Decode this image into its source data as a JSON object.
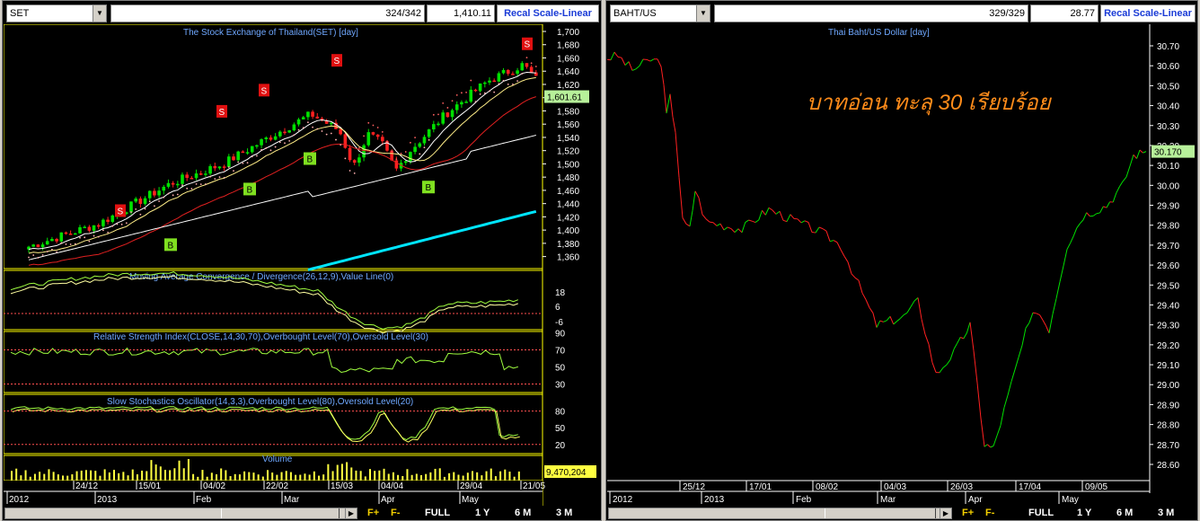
{
  "left": {
    "symbol": "SET",
    "count": "324/342",
    "price": "1,410.11",
    "scale": "Recal Scale-Linear",
    "title": "The Stock Exchange of Thailand(SET) [day]",
    "price_tag": "1,601.61",
    "volume_tag": "9,470,204",
    "y_ticks": [
      "1,700",
      "1,680",
      "1,660",
      "1,640",
      "1,620",
      "1,600",
      "1,580",
      "1,560",
      "1,540",
      "1,520",
      "1,500",
      "1,480",
      "1,460",
      "1,440",
      "1,420",
      "1,400",
      "1,380",
      "1,360"
    ],
    "macd_title": "Moving Average Convergence / Divergence(26,12,9),Value Line(0)",
    "macd_ticks": [
      "18",
      "6",
      "-6"
    ],
    "rsi_title": "Relative Strength Index(CLOSE,14,30,70),Overbought Level(70),Oversold Level(30)",
    "rsi_ticks": [
      "90",
      "70",
      "50",
      "30"
    ],
    "sto_title": "Slow Stochastics Oscillator(14,3,3),Overbought Level(80),Oversold Level(20)",
    "sto_ticks": [
      "80",
      "50",
      "20"
    ],
    "vol_title": "Volume",
    "date_labels": [
      "24/12",
      "15/01",
      "04/02",
      "22/02",
      "15/03",
      "04/04",
      "29/04",
      "21/05"
    ],
    "month_labels": [
      "2012",
      "2013",
      "Feb",
      "Mar",
      "Apr",
      "May"
    ],
    "signals": [
      "S",
      "S",
      "S",
      "S",
      "S",
      "S",
      "B",
      "B",
      "B",
      "B",
      "B"
    ],
    "buttons": {
      "f_plus": "F+",
      "f_minus": "F-",
      "full": "FULL",
      "y1": "1 Y",
      "m6": "6 M",
      "m3": "3 M"
    }
  },
  "right": {
    "symbol": "BAHT/US",
    "count": "329/329",
    "price": "28.77",
    "scale": "Recal Scale-Linear",
    "title": "Thai Baht/US Dollar [day]",
    "price_tag": "30.170",
    "annotation": "บาทอ่อน ทะลุ 30 เรียบร้อย",
    "y_ticks": [
      "30.70",
      "30.60",
      "30.50",
      "30.40",
      "30.30",
      "30.20",
      "30.10",
      "30.00",
      "29.90",
      "29.80",
      "29.70",
      "29.60",
      "29.50",
      "29.40",
      "29.30",
      "29.20",
      "29.10",
      "29.00",
      "28.90",
      "28.80",
      "28.70",
      "28.60"
    ],
    "date_labels": [
      "25/12",
      "17/01",
      "08/02",
      "04/03",
      "26/03",
      "17/04",
      "09/05"
    ],
    "month_labels": [
      "2012",
      "2013",
      "Feb",
      "Mar",
      "Apr",
      "May"
    ],
    "buttons": {
      "f_plus": "F+",
      "f_minus": "F-",
      "full": "FULL",
      "y1": "1 Y",
      "m6": "6 M",
      "m3": "3 M"
    }
  },
  "colors": {
    "up": "#00e000",
    "down": "#ff2020",
    "accent": "#ffff00",
    "ma_long": "#00e5ff"
  }
}
